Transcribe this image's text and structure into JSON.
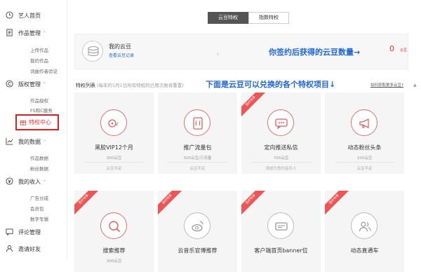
{
  "sidebar": {
    "groups": [
      {
        "label": "艺人首页",
        "icon": "clock-icon",
        "caret": ""
      },
      {
        "label": "作品管理",
        "icon": "document-icon",
        "caret": "⌃"
      },
      {
        "label": "版权管理",
        "icon": "copyright-icon",
        "caret": "⌃"
      },
      {
        "label": "我的数据",
        "icon": "chart-icon",
        "caret": "⌃"
      },
      {
        "label": "我的收入",
        "icon": "coin-icon",
        "caret": "⌃"
      },
      {
        "label": "评论管理",
        "icon": "comment-icon",
        "caret": ""
      },
      {
        "label": "邀请好友",
        "icon": "user-icon",
        "caret": ""
      }
    ],
    "subs": {
      "works": [
        "上传作品",
        "我的作品",
        "词曲作者验证"
      ],
      "copyright": [
        "作品授权",
        "FS和C服务"
      ],
      "data": [
        "作品数据",
        "粉丝数据"
      ],
      "income": [
        "广告分成",
        "会员包",
        "数字专辑"
      ]
    },
    "active": {
      "label": "特权中心",
      "icon": "gift-icon"
    }
  },
  "tabs": [
    {
      "label": "云豆特权",
      "active": true
    },
    {
      "label": "指数特权",
      "active": false
    }
  ],
  "cloud": {
    "title": "我的云豆",
    "link": "查看云豆记录",
    "value": "0",
    "unit": "云豆",
    "tiny_mark": "↑"
  },
  "annotations": {
    "top": "你签约后获得的云豆数量→",
    "middle": "下面是云豆可以兑换的各个特权项目↓"
  },
  "list": {
    "title": "特权列表",
    "subtitle": "(每年的1月1日所有特权的已用次数将重置)",
    "help": "如何获取更多云豆?",
    "scroll_indicator": "▲"
  },
  "cards": [
    {
      "name": "黑胶VIP12个月",
      "meta": "300云豆",
      "status": "云豆不足",
      "ribbon": "",
      "icon": "vinyl-icon"
    },
    {
      "name": "推广流量包",
      "meta": "500云豆/万流量",
      "status": "云豆不足",
      "ribbon": "",
      "icon": "phone-promo-icon"
    },
    {
      "name": "定向推送私信",
      "meta": "700云豆",
      "status": "须成为签约音乐人",
      "ribbon": "签约专享",
      "icon": "message-icon"
    },
    {
      "name": "动态粉丝头条",
      "meta": "100云豆",
      "status": "云豆不足",
      "ribbon": "",
      "icon": "megaphone-icon"
    },
    {
      "name": "搜索推荐",
      "meta": "300云豆",
      "status": "",
      "ribbon": "签约专享",
      "icon": "search-icon"
    },
    {
      "name": "云音乐官博推荐",
      "meta": "",
      "status": "",
      "ribbon": "签约专享",
      "icon": "weibo-icon"
    },
    {
      "name": "客户端首页banner位",
      "meta": "",
      "status": "",
      "ribbon": "签约专享",
      "icon": "banner-icon"
    },
    {
      "name": "动态直通车",
      "meta": "",
      "status": "",
      "ribbon": "签约专享",
      "icon": "users-icon"
    }
  ],
  "colors": {
    "accent": "#e03030",
    "annotation": "#1f66d8",
    "tab_active": "#555555"
  }
}
